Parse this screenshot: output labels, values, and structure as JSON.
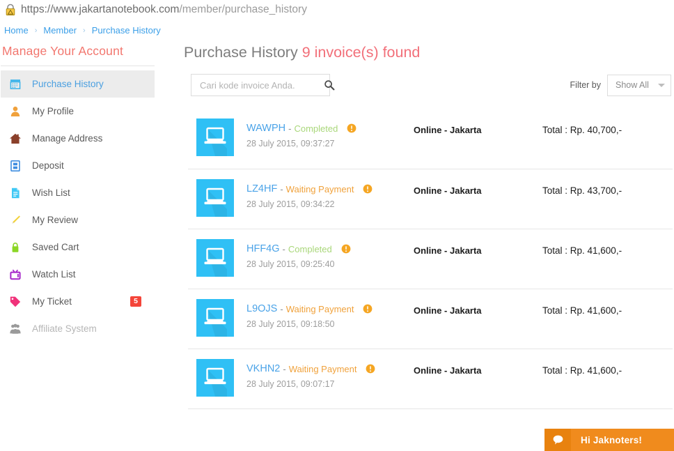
{
  "browser": {
    "lock_icon": "warning-lock-icon",
    "url_domain": "https://www.jakartanotebook.com",
    "url_path": "/member/purchase_history"
  },
  "breadcrumb": {
    "separator": "›",
    "items": [
      {
        "label": "Home",
        "name": "home"
      },
      {
        "label": "Member",
        "name": "member"
      },
      {
        "label": "Purchase History",
        "name": "purchase-history"
      }
    ]
  },
  "sidebar": {
    "title": "Manage Your Account",
    "items": [
      {
        "label": "Purchase History",
        "icon": "receipt-icon",
        "color": "#39b3ea",
        "active": true,
        "badge": null
      },
      {
        "label": "My Profile",
        "icon": "user-icon",
        "color": "#f0a13c",
        "active": false,
        "badge": null
      },
      {
        "label": "Manage Address",
        "icon": "home-icon",
        "color": "#8a3f2a",
        "active": false,
        "badge": null
      },
      {
        "label": "Deposit",
        "icon": "wallet-icon",
        "color": "#3f8de0",
        "active": false,
        "badge": null
      },
      {
        "label": "Wish List",
        "icon": "document-icon",
        "color": "#3fc8f5",
        "active": false,
        "badge": null
      },
      {
        "label": "My Review",
        "icon": "pencil-icon",
        "color": "#f2d23a",
        "active": false,
        "badge": null
      },
      {
        "label": "Saved Cart",
        "icon": "lock-icon",
        "color": "#8bd625",
        "active": false,
        "badge": null
      },
      {
        "label": "Watch List",
        "icon": "tv-icon",
        "color": "#a526c9",
        "active": false,
        "badge": null
      },
      {
        "label": "My Ticket",
        "icon": "tag-icon",
        "color": "#f0327a",
        "active": false,
        "badge": "5"
      },
      {
        "label": "Affiliate System",
        "icon": "people-icon",
        "color": "#9a9a9a",
        "active": false,
        "badge": null,
        "disabled": true
      }
    ]
  },
  "main": {
    "title": "Purchase History",
    "count_text": "9 invoice(s) found",
    "search": {
      "placeholder": "Cari kode invoice Anda.",
      "value": "",
      "icon": "search-icon"
    },
    "filter": {
      "label": "Filter by",
      "selected": "Show All",
      "icon": "chevron-down-icon"
    },
    "invoices": [
      {
        "code": "WAWPH",
        "dash": "-",
        "status": "Completed",
        "status_type": "completed",
        "date": "28 July 2015, 09:37:27",
        "channel": "Online - Jakarta",
        "total": "Total : Rp. 40,700,-",
        "thumb": "laptop-icon",
        "info": "info-icon"
      },
      {
        "code": "LZ4HF",
        "dash": "-",
        "status": "Waiting Payment",
        "status_type": "waiting",
        "date": "28 July 2015, 09:34:22",
        "channel": "Online - Jakarta",
        "total": "Total : Rp. 43,700,-",
        "thumb": "laptop-icon",
        "info": "info-icon"
      },
      {
        "code": "HFF4G",
        "dash": "-",
        "status": "Completed",
        "status_type": "completed",
        "date": "28 July 2015, 09:25:40",
        "channel": "Online - Jakarta",
        "total": "Total : Rp. 41,600,-",
        "thumb": "laptop-icon",
        "info": "info-icon"
      },
      {
        "code": "L9OJS",
        "dash": "-",
        "status": "Waiting Payment",
        "status_type": "waiting",
        "date": "28 July 2015, 09:18:50",
        "channel": "Online - Jakarta",
        "total": "Total : Rp. 41,600,-",
        "thumb": "laptop-icon",
        "info": "info-icon"
      },
      {
        "code": "VKHN2",
        "dash": "-",
        "status": "Waiting Payment",
        "status_type": "waiting",
        "date": "28 July 2015, 09:07:17",
        "channel": "Online - Jakarta",
        "total": "Total : Rp. 41,600,-",
        "thumb": "laptop-icon",
        "info": "info-icon"
      }
    ]
  },
  "chat": {
    "label": "Hi Jaknoters!",
    "icon": "chat-bubble-icon"
  },
  "colors": {
    "accent_blue": "#4aa3e8",
    "title_red": "#f2707a",
    "thumb_blue": "#2fc0f5",
    "status_green": "#a9d77a",
    "status_orange": "#f0a23c",
    "badge_red": "#f4453a",
    "chat_orange": "#f08b1d"
  }
}
